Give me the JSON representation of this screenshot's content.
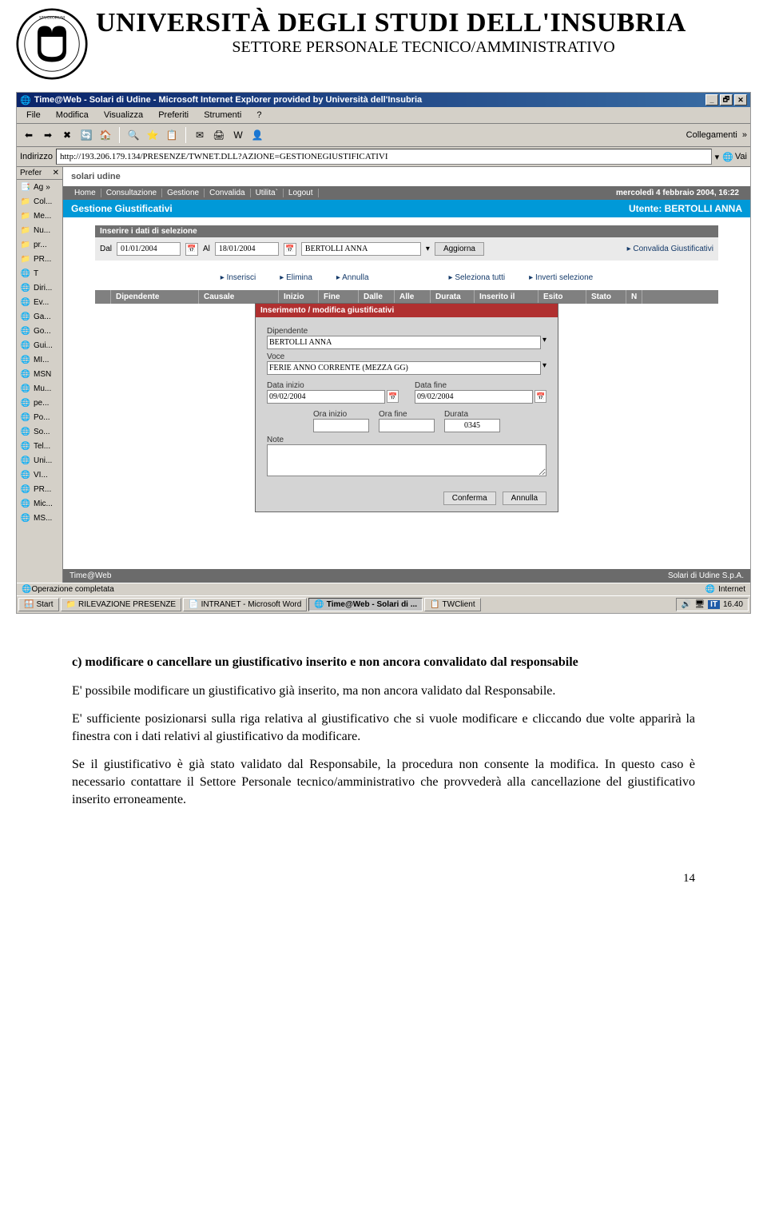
{
  "header": {
    "university": "UNIVERSITÀ DEGLI STUDI DELL'INSUBRIA",
    "sector": "SETTORE PERSONALE TECNICO/AMMINISTRATIVO"
  },
  "window": {
    "title": "Time@Web - Solari di Udine - Microsoft Internet Explorer provided by Università dell'Insubria",
    "menu": {
      "file": "File",
      "modifica": "Modifica",
      "visualizza": "Visualizza",
      "preferiti": "Preferiti",
      "strumenti": "Strumenti",
      "help": "?"
    },
    "toolbar_right": "Collegamenti",
    "addr_label": "Indirizzo",
    "addr_url": "http://193.206.179.134/PRESENZE/TWNET.DLL?AZIONE=GESTIONEGIUSTIFICATIVI",
    "go": "Vai"
  },
  "sidebar": {
    "prefer": "Prefer",
    "ag": "Ag",
    "items": [
      "Col...",
      "Me...",
      "Nu...",
      "pr...",
      "PR...",
      "T",
      "Diri...",
      "Ev...",
      "Ga...",
      "Go...",
      "Gui...",
      "MI...",
      "MSN",
      "Mu...",
      "pe...",
      "Po...",
      "So...",
      "Tel...",
      "Uni...",
      "VI...",
      "PR...",
      "Mic...",
      "MS..."
    ]
  },
  "app": {
    "brand": "solari udine",
    "menu": {
      "home": "Home",
      "cons": "Consultazione",
      "gest": "Gestione",
      "conv": "Convalida",
      "util": "Utilita`",
      "logout": "Logout"
    },
    "date": "mercoledì 4 febbraio 2004, 16:22",
    "subtitle": "Gestione Giustificativi",
    "user_label": "Utente: BERTOLLI ANNA",
    "sel": {
      "header": "Inserire i dati di selezione",
      "dal": "Dal",
      "dal_v": "01/01/2004",
      "al": "Al",
      "al_v": "18/01/2004",
      "nome": "BERTOLLI ANNA",
      "aggiorna": "Aggiorna",
      "convalida": "Convalida Giustificativi"
    },
    "actions": {
      "ins": "Inserisci",
      "elim": "Elimina",
      "ann": "Annulla",
      "seltutti": "Seleziona tutti",
      "inv": "Inverti selezione"
    },
    "table": {
      "dip": "Dipendente",
      "caus": "Causale",
      "inizio": "Inizio",
      "fine": "Fine",
      "dalle": "Dalle",
      "alle": "Alle",
      "durata": "Durata",
      "insil": "Inserito il",
      "esito": "Esito",
      "stato": "Stato",
      "n": "N"
    },
    "popup": {
      "title": "Inserimento / modifica giustificativi",
      "dip": "Dipendente",
      "dip_v": "BERTOLLI ANNA",
      "voce": "Voce",
      "voce_v": "FERIE ANNO CORRENTE (MEZZA GG)",
      "di": "Data inizio",
      "di_v": "09/02/2004",
      "df": "Data fine",
      "df_v": "09/02/2004",
      "oi": "Ora inizio",
      "of": "Ora fine",
      "dur": "Durata",
      "dur_v": "0345",
      "note": "Note",
      "conferma": "Conferma",
      "annulla": "Annulla"
    },
    "footer_l": "Time@Web",
    "footer_r": "Solari di Udine S.p.A."
  },
  "status": {
    "left": "Operazione completata",
    "right": "Internet"
  },
  "taskbar": {
    "start": "Start",
    "t1": "RILEVAZIONE PRESENZE",
    "t2": "INTRANET - Microsoft Word",
    "t3": "Time@Web - Solari di ...",
    "t4": "TWClient",
    "lang": "IT",
    "time": "16.40"
  },
  "doc": {
    "title": "c) modificare o cancellare un giustificativo inserito e non ancora convalidato dal responsabile",
    "p1": "E' possibile modificare un giustificativo già inserito, ma non ancora validato dal Responsabile.",
    "p2": "E' sufficiente posizionarsi sulla riga relativa al giustificativo che si vuole modificare e cliccando due volte apparirà la finestra con i dati relativi al giustificativo da modificare.",
    "p3": "Se il giustificativo è già stato validato dal Responsabile, la procedura non consente la modifica. In questo caso è necessario contattare il Settore Personale tecnico/amministrativo che provvederà alla cancellazione del giustificativo inserito erroneamente.",
    "page": "14"
  }
}
